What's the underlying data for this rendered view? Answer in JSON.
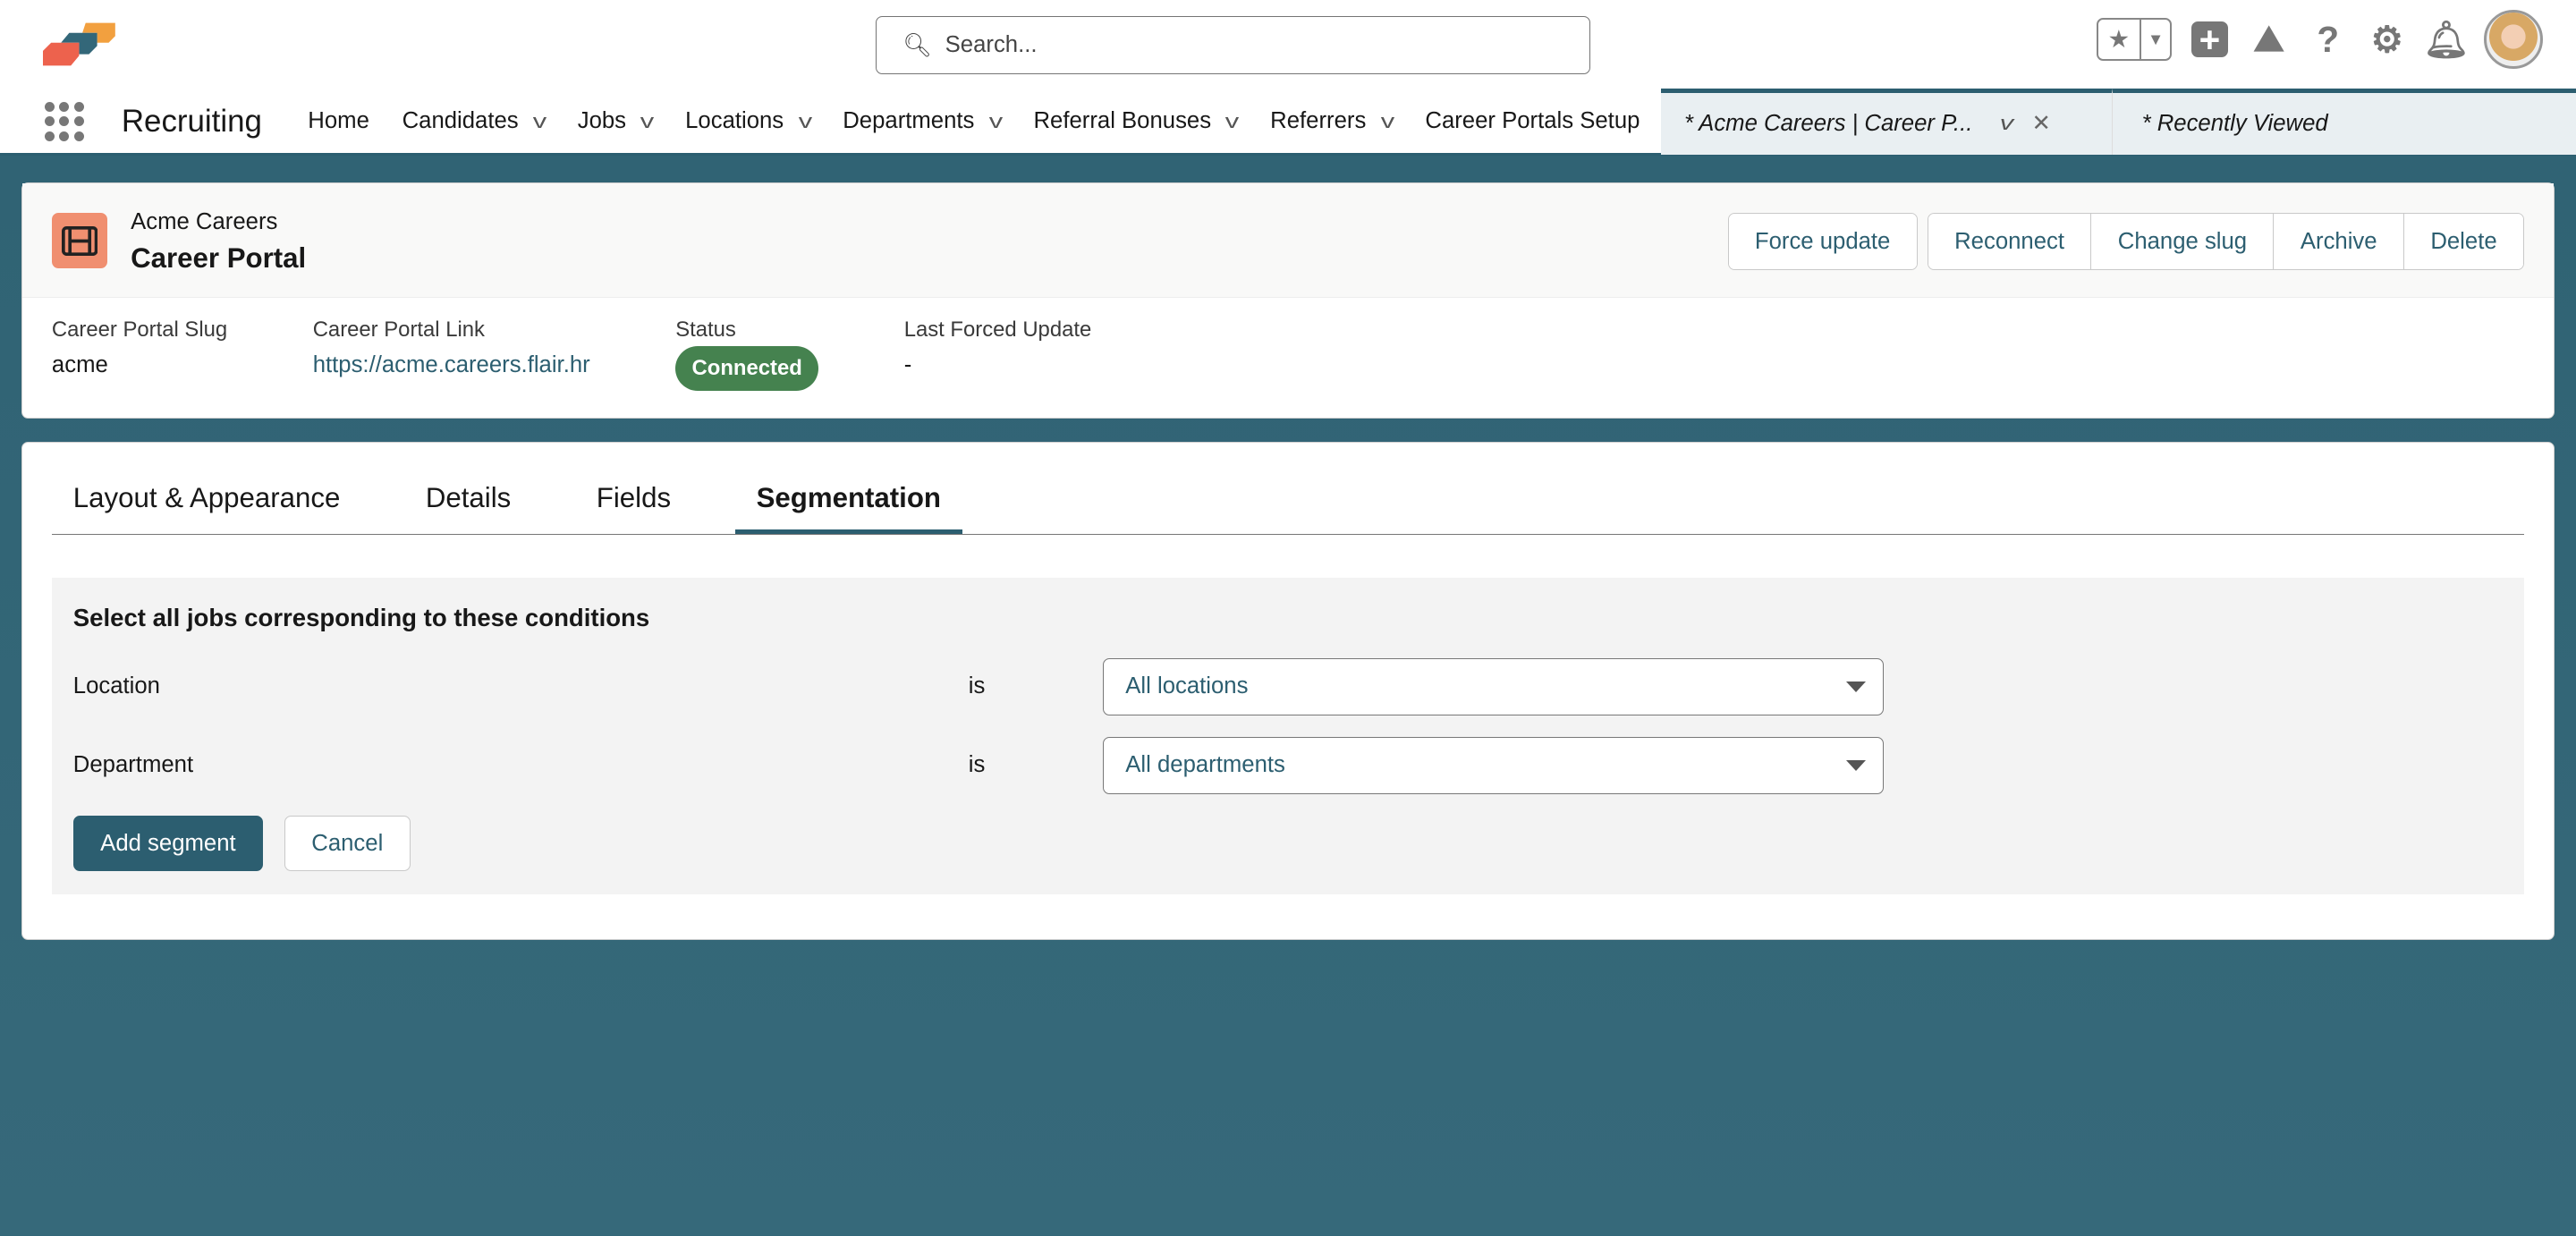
{
  "header": {
    "search_placeholder": "Search...",
    "app_name": "Recruiting",
    "icons": [
      "favorites-star-icon",
      "add-icon",
      "trailhead-icon",
      "help-icon",
      "setup-gear-icon",
      "notifications-bell-icon",
      "avatar"
    ]
  },
  "nav": {
    "items": [
      {
        "label": "Home",
        "dropdown": false
      },
      {
        "label": "Candidates",
        "dropdown": true
      },
      {
        "label": "Jobs",
        "dropdown": true
      },
      {
        "label": "Locations",
        "dropdown": true
      },
      {
        "label": "Departments",
        "dropdown": true
      },
      {
        "label": "Referral Bonuses",
        "dropdown": true
      },
      {
        "label": "Referrers",
        "dropdown": true
      },
      {
        "label": "Career Portals Setup",
        "dropdown": false
      }
    ],
    "open_tab": "* Acme Careers | Career P...",
    "recent_tab": "* Recently Viewed"
  },
  "record": {
    "subtitle": "Acme Careers",
    "title": "Career Portal",
    "actions": {
      "force_update": "Force update",
      "reconnect": "Reconnect",
      "change_slug": "Change slug",
      "archive": "Archive",
      "delete": "Delete"
    },
    "fields": {
      "slug_label": "Career Portal Slug",
      "slug": "acme",
      "link_label": "Career Portal Link",
      "link": "https://acme.careers.flair.hr",
      "status_label": "Status",
      "status": "Connected",
      "last_label": "Last Forced Update",
      "last": "-"
    }
  },
  "tabs": [
    "Layout & Appearance",
    "Details",
    "Fields",
    "Segmentation"
  ],
  "active_tab": "Segmentation",
  "segment": {
    "heading": "Select all jobs corresponding to these conditions",
    "location_label": "Location",
    "location_op": "is",
    "location_value": "All locations",
    "department_label": "Department",
    "department_op": "is",
    "department_value": "All departments",
    "add": "Add segment",
    "cancel": "Cancel"
  },
  "colors": {
    "brand": "#2c5e70",
    "status_connected": "#45824f",
    "record_icon": "#f08f70"
  }
}
